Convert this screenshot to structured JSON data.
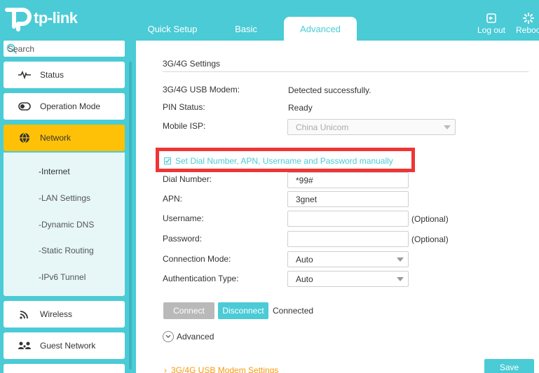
{
  "brand": {
    "name": "tp-link"
  },
  "nav": {
    "tabs": [
      {
        "label": "Quick Setup"
      },
      {
        "label": "Basic"
      },
      {
        "label": "Advanced"
      }
    ],
    "logout": "Log out",
    "reboot": "Reboo"
  },
  "sidebar": {
    "search_placeholder": "Search",
    "items": [
      {
        "label": "Status",
        "icon": "pulse-icon"
      },
      {
        "label": "Operation Mode",
        "icon": "toggle-icon"
      },
      {
        "label": "Network",
        "icon": "globe-icon"
      },
      {
        "label": "Wireless",
        "icon": "wifi-icon"
      },
      {
        "label": "Guest Network",
        "icon": "guests-icon"
      }
    ],
    "network_sub": [
      {
        "label": "-Internet"
      },
      {
        "label": "-LAN Settings"
      },
      {
        "label": "-Dynamic DNS"
      },
      {
        "label": "-Static Routing"
      },
      {
        "label": "-IPv6 Tunnel"
      }
    ]
  },
  "main": {
    "section_title": "3G/4G Settings",
    "modem_label": "3G/4G USB Modem:",
    "modem_value": "Detected successfully.",
    "pin_label": "PIN Status:",
    "pin_value": "Ready",
    "isp_label": "Mobile ISP:",
    "isp_value": "China Unicom",
    "manual_checkbox": "Set Dial Number, APN, Username and Password manually",
    "dial_label": "Dial Number:",
    "dial_value": "*99#",
    "apn_label": "APN:",
    "apn_value": "3gnet",
    "username_label": "Username:",
    "username_value": "",
    "password_label": "Password:",
    "password_value": "",
    "optional": "(Optional)",
    "conn_mode_label": "Connection Mode:",
    "conn_mode_value": "Auto",
    "auth_label": "Authentication Type:",
    "auth_value": "Auto",
    "connect_btn": "Connect",
    "disconnect_btn": "Disconnect",
    "status": "Connected",
    "advanced": "Advanced",
    "usb_settings_link": "3G/4G USB Modem Settings",
    "save_btn": "Save"
  },
  "colors": {
    "accent": "#4acbd6",
    "active": "#ffc107",
    "highlight": "#ee3535",
    "link": "#f39c12"
  }
}
